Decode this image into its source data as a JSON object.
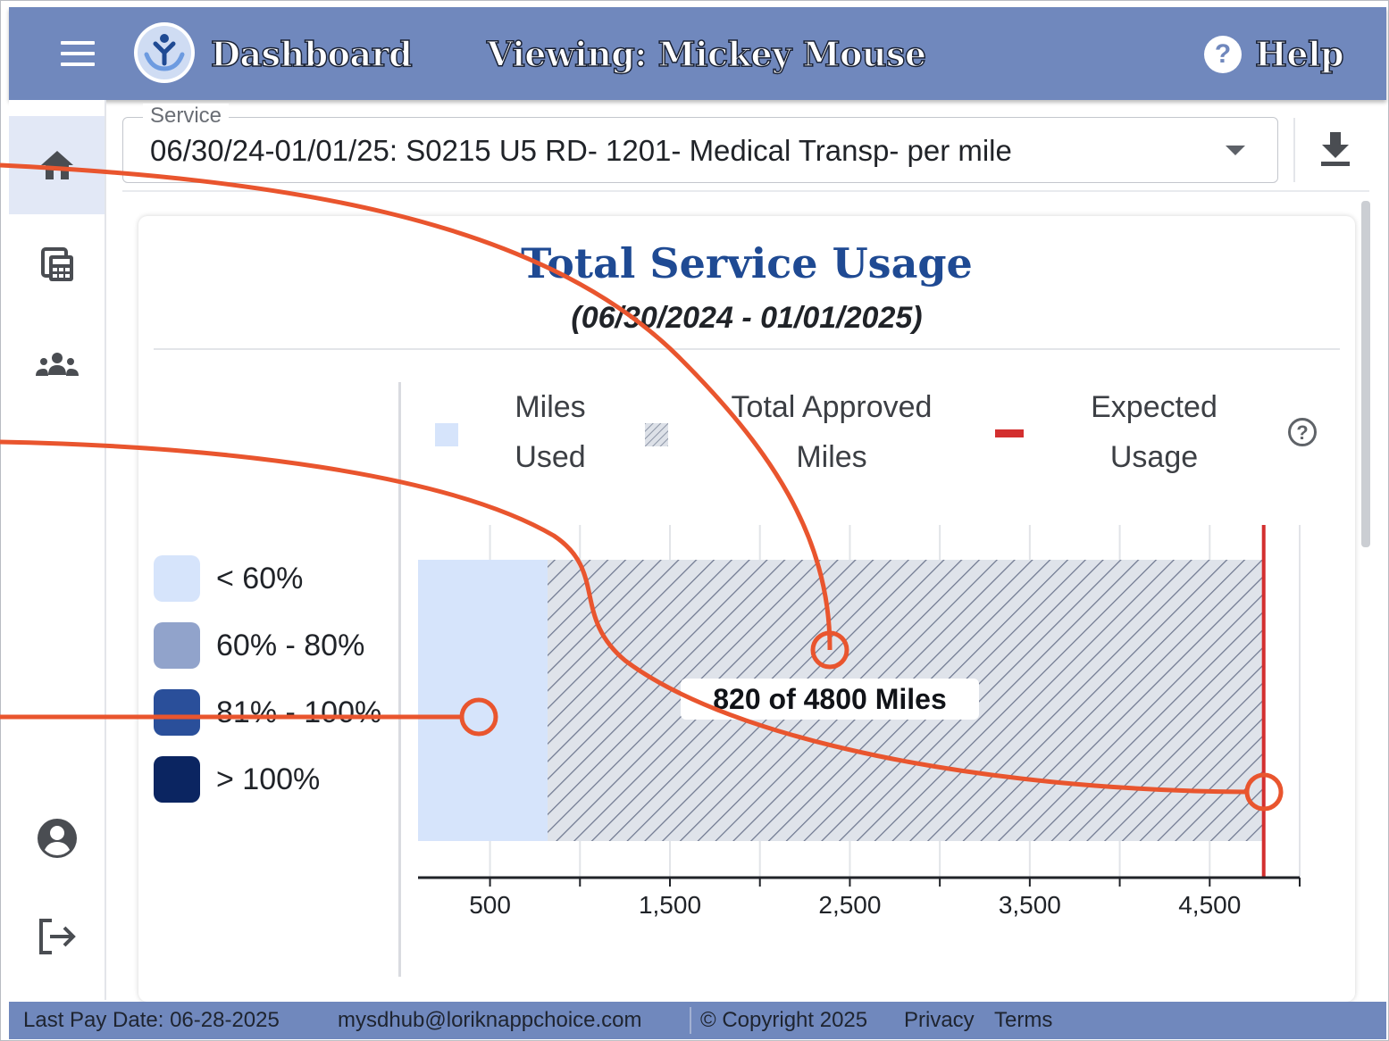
{
  "header": {
    "title": "Dashboard",
    "viewing": "Viewing: Mickey Mouse",
    "help_icon": "?",
    "help_label": "Help",
    "color": "#7088bd"
  },
  "sidebar": {
    "items": [
      {
        "name": "home-icon",
        "active": true
      },
      {
        "name": "calendar-calculator-icon",
        "active": false
      },
      {
        "name": "people-group-icon",
        "active": false
      },
      {
        "name": "account-icon",
        "active": false
      },
      {
        "name": "logout-icon",
        "active": false
      }
    ]
  },
  "service": {
    "label": "Service",
    "value": "06/30/24-01/01/25: S0215 U5 RD- 1201- Medical Transp- per mile",
    "download_icon": "download-icon"
  },
  "card": {
    "title": "Total Service Usage",
    "subtitle": "(06/30/2024 - 01/01/2025)"
  },
  "usage_key": [
    {
      "label": "< 60%",
      "color": "#d6e4fb"
    },
    {
      "label": "60% - 80%",
      "color": "#91a3cb"
    },
    {
      "label": "81% - 100%",
      "color": "#2a4f9a"
    },
    {
      "label": "> 100%",
      "color": "#0b2561"
    }
  ],
  "legend": {
    "miles_used": [
      "Miles",
      "Used"
    ],
    "approved": [
      "Total Approved",
      "Miles"
    ],
    "expected": [
      "Expected",
      "Usage"
    ],
    "help_icon": "?"
  },
  "chart_data": {
    "type": "bar",
    "orientation": "horizontal",
    "x_ticks": [
      "500",
      "1,500",
      "2,500",
      "3,500",
      "4,500"
    ],
    "xlim": [
      100,
      5000
    ],
    "grid": true,
    "series": [
      {
        "name": "Miles Used",
        "values": [
          820
        ],
        "color": "#d6e4fb"
      },
      {
        "name": "Total Approved Miles",
        "values": [
          4800
        ],
        "pattern": "diagonal-hatch"
      },
      {
        "name": "Expected Usage",
        "values": [
          4800
        ],
        "color": "#d32f2f",
        "kind": "line"
      }
    ],
    "annotation": "820 of 4800 Miles"
  },
  "footer": {
    "pay_date": "Last Pay Date: 06-28-2025",
    "email": "mysdhub@loriknappchoice.com",
    "copyright": "© Copyright 2025",
    "privacy": "Privacy",
    "terms": "Terms"
  },
  "callout_color": "#e9552e"
}
